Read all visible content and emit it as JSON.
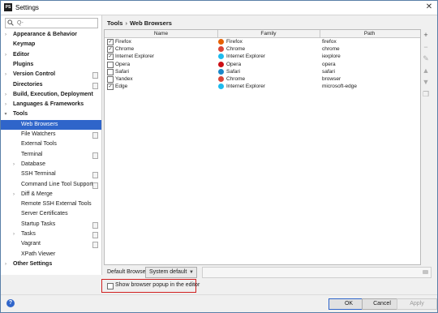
{
  "window": {
    "title": "Settings",
    "app_icon_text": "PS"
  },
  "search": {
    "placeholder": "Q-"
  },
  "sidebar": {
    "items": [
      {
        "label": "Appearance & Behavior",
        "bold": true,
        "level": 0,
        "arrow": "right",
        "copy": false
      },
      {
        "label": "Keymap",
        "bold": true,
        "level": 0,
        "arrow": "",
        "copy": false
      },
      {
        "label": "Editor",
        "bold": true,
        "level": 0,
        "arrow": "right",
        "copy": false
      },
      {
        "label": "Plugins",
        "bold": true,
        "level": 0,
        "arrow": "",
        "copy": false
      },
      {
        "label": "Version Control",
        "bold": true,
        "level": 0,
        "arrow": "right",
        "copy": true
      },
      {
        "label": "Directories",
        "bold": true,
        "level": 0,
        "arrow": "",
        "copy": true
      },
      {
        "label": "Build, Execution, Deployment",
        "bold": true,
        "level": 0,
        "arrow": "right",
        "copy": false
      },
      {
        "label": "Languages & Frameworks",
        "bold": true,
        "level": 0,
        "arrow": "right",
        "copy": false
      },
      {
        "label": "Tools",
        "bold": true,
        "level": 0,
        "arrow": "down",
        "copy": false
      },
      {
        "label": "Web Browsers",
        "bold": false,
        "level": 1,
        "arrow": "",
        "copy": false,
        "selected": true
      },
      {
        "label": "File Watchers",
        "bold": false,
        "level": 1,
        "arrow": "",
        "copy": true
      },
      {
        "label": "External Tools",
        "bold": false,
        "level": 1,
        "arrow": "",
        "copy": false
      },
      {
        "label": "Terminal",
        "bold": false,
        "level": 1,
        "arrow": "",
        "copy": true
      },
      {
        "label": "Database",
        "bold": false,
        "level": 1,
        "arrow": "right",
        "copy": false
      },
      {
        "label": "SSH Terminal",
        "bold": false,
        "level": 1,
        "arrow": "",
        "copy": true
      },
      {
        "label": "Command Line Tool Support",
        "bold": false,
        "level": 1,
        "arrow": "",
        "copy": true
      },
      {
        "label": "Diff & Merge",
        "bold": false,
        "level": 1,
        "arrow": "right",
        "copy": false
      },
      {
        "label": "Remote SSH External Tools",
        "bold": false,
        "level": 1,
        "arrow": "",
        "copy": false
      },
      {
        "label": "Server Certificates",
        "bold": false,
        "level": 1,
        "arrow": "",
        "copy": false
      },
      {
        "label": "Startup Tasks",
        "bold": false,
        "level": 1,
        "arrow": "",
        "copy": true
      },
      {
        "label": "Tasks",
        "bold": false,
        "level": 1,
        "arrow": "right",
        "copy": true
      },
      {
        "label": "Vagrant",
        "bold": false,
        "level": 1,
        "arrow": "",
        "copy": true
      },
      {
        "label": "XPath Viewer",
        "bold": false,
        "level": 1,
        "arrow": "",
        "copy": false
      },
      {
        "label": "Other Settings",
        "bold": true,
        "level": 0,
        "arrow": "right",
        "copy": false
      }
    ]
  },
  "breadcrumb": {
    "root": "Tools",
    "separator": "›",
    "current": "Web Browsers"
  },
  "table": {
    "columns": [
      "Name",
      "Family",
      "Path"
    ],
    "rows": [
      {
        "checked": true,
        "name": "Firefox",
        "family": "Firefox",
        "family_icon": "firefox-icon",
        "family_color": "#e66000",
        "path": "firefox"
      },
      {
        "checked": true,
        "name": "Chrome",
        "family": "Chrome",
        "family_icon": "chrome-icon",
        "family_color": "#db4437",
        "path": "chrome"
      },
      {
        "checked": true,
        "name": "Internet Explorer",
        "family": "Internet Explorer",
        "family_icon": "ie-icon",
        "family_color": "#1ebbee",
        "path": "iexplore"
      },
      {
        "checked": false,
        "name": "Opera",
        "family": "Opera",
        "family_icon": "opera-icon",
        "family_color": "#cc0f16",
        "path": "opera"
      },
      {
        "checked": false,
        "name": "Safari",
        "family": "Safari",
        "family_icon": "safari-icon",
        "family_color": "#1b88ca",
        "path": "safari"
      },
      {
        "checked": false,
        "name": "Yandex",
        "family": "Chrome",
        "family_icon": "chrome-icon",
        "family_color": "#db4437",
        "path": "browser"
      },
      {
        "checked": true,
        "name": "Edge",
        "family": "Internet Explorer",
        "family_icon": "ie-icon",
        "family_color": "#1ebbee",
        "path": "microsoft-edge"
      }
    ]
  },
  "side_tools": [
    {
      "icon": "add-icon",
      "glyph": "+",
      "enabled": true
    },
    {
      "icon": "remove-icon",
      "glyph": "−",
      "enabled": false
    },
    {
      "icon": "edit-icon",
      "glyph": "✎",
      "enabled": false
    },
    {
      "icon": "move-up-icon",
      "glyph": "▲",
      "enabled": false
    },
    {
      "icon": "move-down-icon",
      "glyph": "▼",
      "enabled": false
    },
    {
      "icon": "copy-icon",
      "glyph": "❐",
      "enabled": false
    }
  ],
  "default_browser": {
    "label": "Default Browser:",
    "value": "System default"
  },
  "popup_option": {
    "label": "Show browser popup in the editor",
    "checked": false
  },
  "footer": {
    "help": "?",
    "ok": "OK",
    "cancel": "Cancel",
    "apply": "Apply"
  },
  "colors": {
    "selection": "#2f65ca",
    "highlight_border": "#d01f1f"
  }
}
